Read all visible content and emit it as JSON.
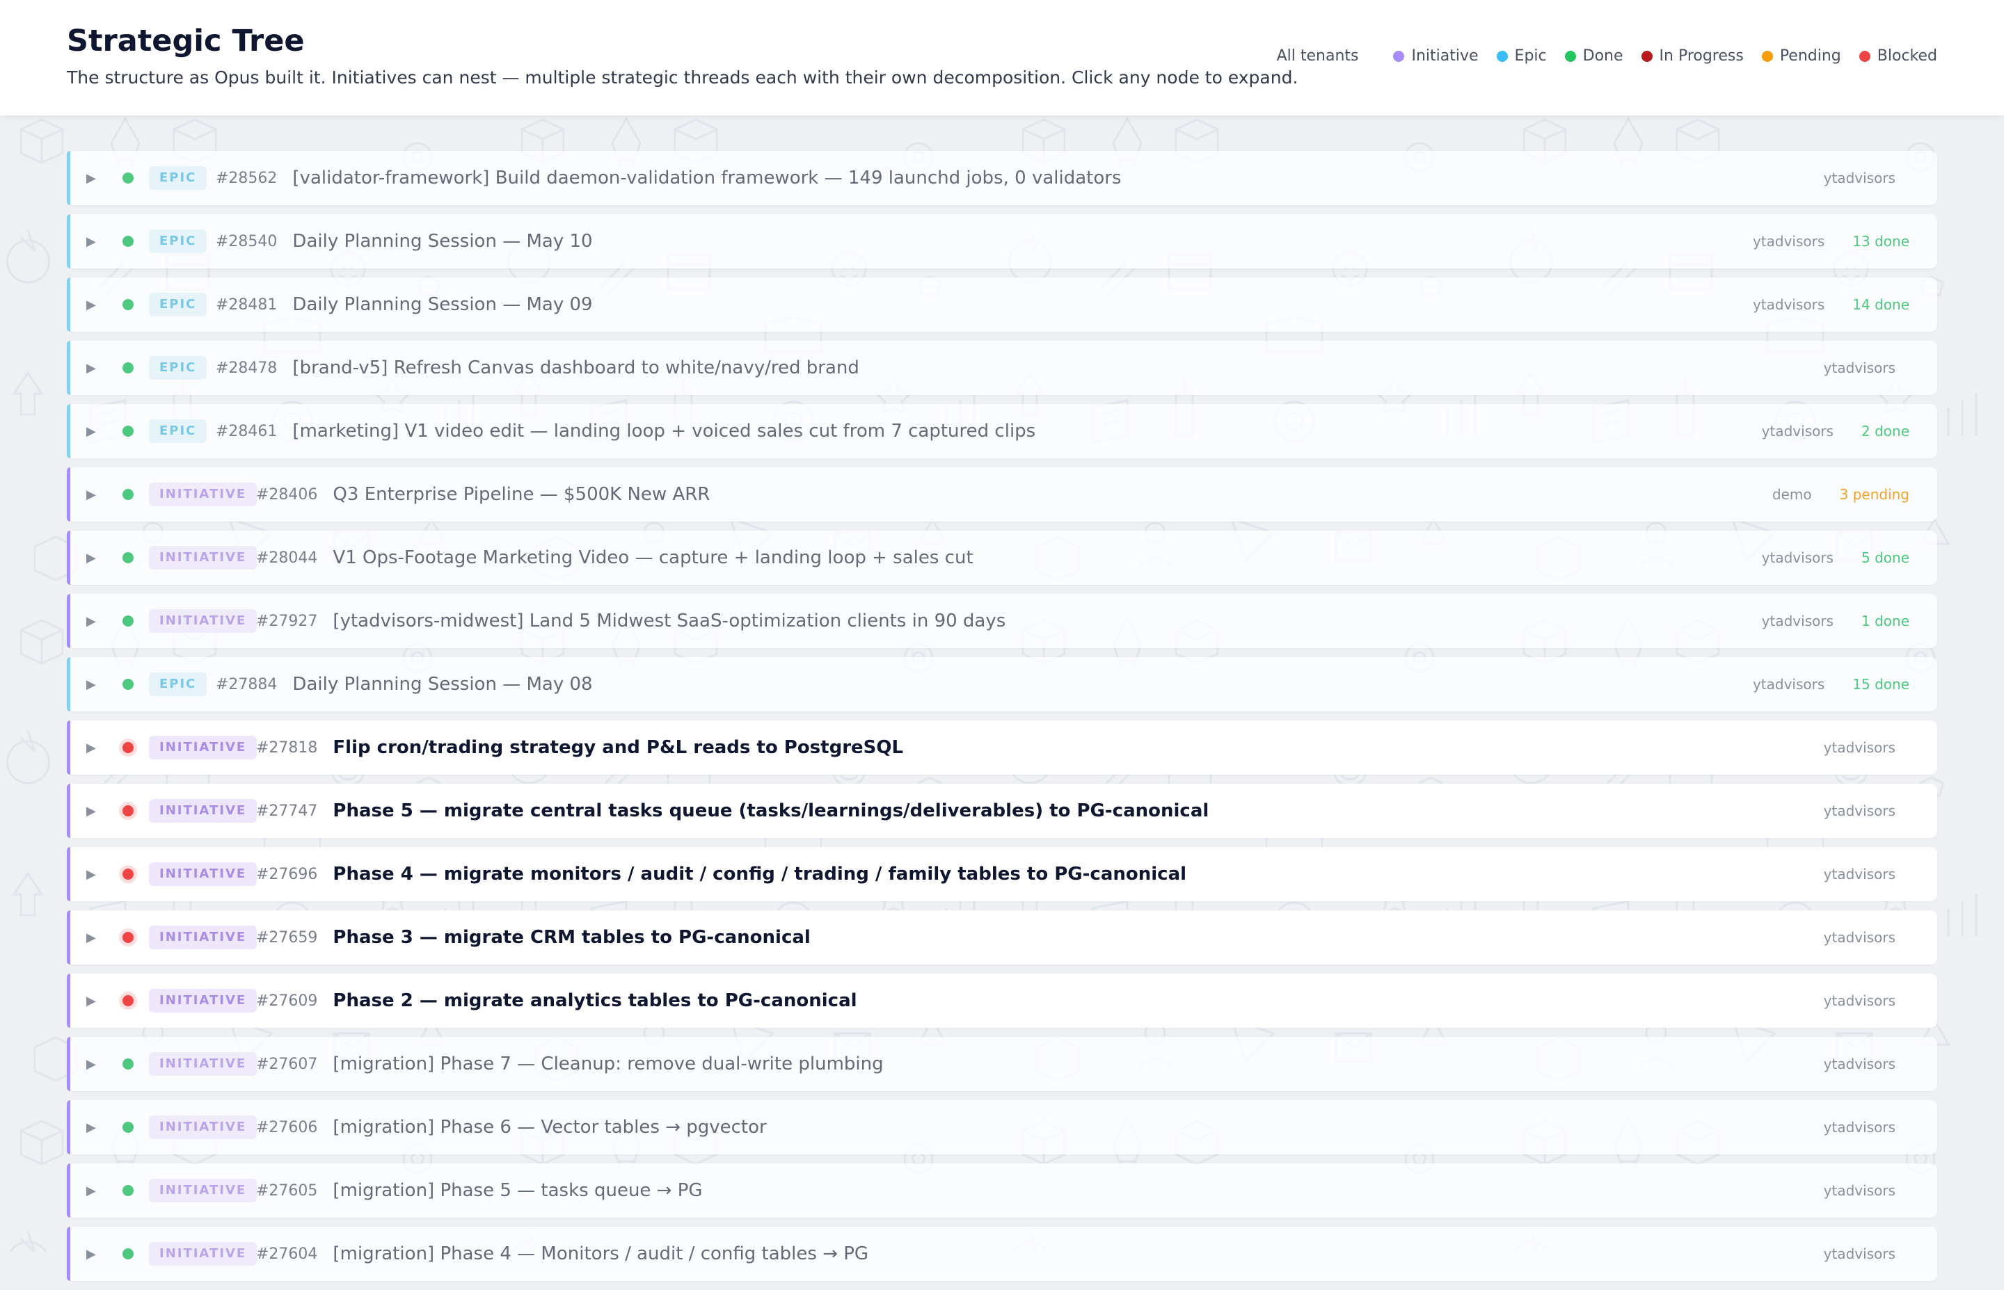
{
  "header": {
    "title": "Strategic Tree",
    "subtitle": "The structure as Opus built it. Initiatives can nest — multiple strategic threads each with their own decomposition. Click any node to expand."
  },
  "legend": {
    "tenants_label": "All tenants",
    "items": [
      {
        "label": "Initiative",
        "color": "#a78bfa"
      },
      {
        "label": "Epic",
        "color": "#38bdf8"
      },
      {
        "label": "Done",
        "color": "#22c55e"
      },
      {
        "label": "In Progress",
        "color": "#b91c1c"
      },
      {
        "label": "Pending",
        "color": "#f59e0b"
      },
      {
        "label": "Blocked",
        "color": "#ef4444"
      }
    ]
  },
  "icons": {
    "expand": "chevron-right-icon"
  },
  "colors": {
    "epic_accent": "#7dd3f0",
    "initiative_accent": "#a78bfa",
    "done": "#4cc97e",
    "blocked": "#ef4444"
  },
  "rows": [
    {
      "type": "EPIC",
      "id": "#28562",
      "title": "[validator-framework] Build daemon-validation framework — 149 launchd jobs, 0 validators",
      "tenant": "ytadvisors",
      "tally": "",
      "status": "done"
    },
    {
      "type": "EPIC",
      "id": "#28540",
      "title": "Daily Planning Session — May 10",
      "tenant": "ytadvisors",
      "tally": "13 done",
      "status": "done"
    },
    {
      "type": "EPIC",
      "id": "#28481",
      "title": "Daily Planning Session — May 09",
      "tenant": "ytadvisors",
      "tally": "14 done",
      "status": "done"
    },
    {
      "type": "EPIC",
      "id": "#28478",
      "title": "[brand-v5] Refresh Canvas dashboard to white/navy/red brand",
      "tenant": "ytadvisors",
      "tally": "",
      "status": "done"
    },
    {
      "type": "EPIC",
      "id": "#28461",
      "title": "[marketing] V1 video edit — landing loop + voiced sales cut from 7 captured clips",
      "tenant": "ytadvisors",
      "tally": "2 done",
      "status": "done"
    },
    {
      "type": "INITIATIVE",
      "id": "#28406",
      "title": "Q3 Enterprise Pipeline — $500K New ARR",
      "tenant": "demo",
      "tally": "3 pending",
      "status": "done"
    },
    {
      "type": "INITIATIVE",
      "id": "#28044",
      "title": "V1 Ops-Footage Marketing Video — capture + landing loop + sales cut",
      "tenant": "ytadvisors",
      "tally": "5 done",
      "status": "done"
    },
    {
      "type": "INITIATIVE",
      "id": "#27927",
      "title": "[ytadvisors-midwest] Land 5 Midwest SaaS-optimization clients in 90 days",
      "tenant": "ytadvisors",
      "tally": "1 done",
      "status": "done"
    },
    {
      "type": "EPIC",
      "id": "#27884",
      "title": "Daily Planning Session — May 08",
      "tenant": "ytadvisors",
      "tally": "15 done",
      "status": "done"
    },
    {
      "type": "INITIATIVE",
      "id": "#27818",
      "title": "Flip cron/trading strategy and P&L reads to PostgreSQL",
      "tenant": "ytadvisors",
      "tally": "",
      "status": "blocked"
    },
    {
      "type": "INITIATIVE",
      "id": "#27747",
      "title": "Phase 5 — migrate central tasks queue (tasks/learnings/deliverables) to PG-canonical",
      "tenant": "ytadvisors",
      "tally": "",
      "status": "blocked"
    },
    {
      "type": "INITIATIVE",
      "id": "#27696",
      "title": "Phase 4 — migrate monitors / audit / config / trading / family tables to PG-canonical",
      "tenant": "ytadvisors",
      "tally": "",
      "status": "blocked"
    },
    {
      "type": "INITIATIVE",
      "id": "#27659",
      "title": "Phase 3 — migrate CRM tables to PG-canonical",
      "tenant": "ytadvisors",
      "tally": "",
      "status": "blocked"
    },
    {
      "type": "INITIATIVE",
      "id": "#27609",
      "title": "Phase 2 — migrate analytics tables to PG-canonical",
      "tenant": "ytadvisors",
      "tally": "",
      "status": "blocked"
    },
    {
      "type": "INITIATIVE",
      "id": "#27607",
      "title": "[migration] Phase 7 — Cleanup: remove dual-write plumbing",
      "tenant": "ytadvisors",
      "tally": "",
      "status": "done"
    },
    {
      "type": "INITIATIVE",
      "id": "#27606",
      "title": "[migration] Phase 6 — Vector tables → pgvector",
      "tenant": "ytadvisors",
      "tally": "",
      "status": "done"
    },
    {
      "type": "INITIATIVE",
      "id": "#27605",
      "title": "[migration] Phase 5 — tasks queue → PG",
      "tenant": "ytadvisors",
      "tally": "",
      "status": "done"
    },
    {
      "type": "INITIATIVE",
      "id": "#27604",
      "title": "[migration] Phase 4 — Monitors / audit / config tables → PG",
      "tenant": "ytadvisors",
      "tally": "",
      "status": "done"
    }
  ]
}
